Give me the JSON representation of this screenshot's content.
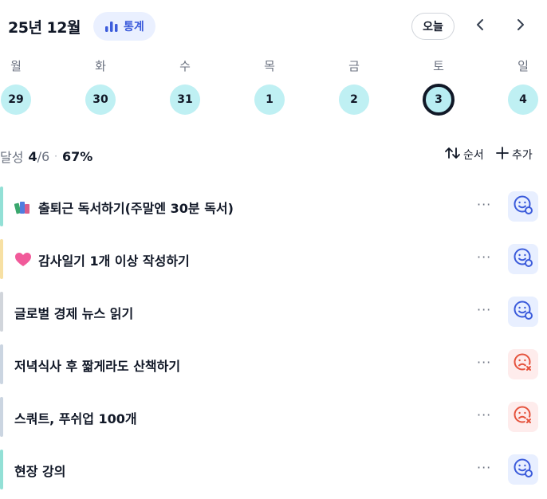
{
  "header": {
    "month_title": "25년 12월",
    "stats_label": "통계",
    "today_label": "오늘",
    "prev_icon": "chevron-left-icon",
    "next_icon": "chevron-right-icon"
  },
  "week": {
    "weekdays": [
      "월",
      "화",
      "수",
      "목",
      "금",
      "토",
      "일"
    ],
    "dates": [
      "29",
      "30",
      "31",
      "1",
      "2",
      "3",
      "4"
    ],
    "selected_index": 5
  },
  "summary": {
    "label": "달성",
    "done": "4",
    "total": "/6",
    "separator": "·",
    "percent": "67%",
    "order_label": "순서",
    "add_label": "추가"
  },
  "habits": [
    {
      "title": "출퇴근 독서하기(주말엔 30분 독서)",
      "emoji": "books-icon",
      "bar_color": "#93e0d6",
      "status": "success"
    },
    {
      "title": "감사일기 1개 이상 작성하기",
      "emoji": "heart-icon",
      "bar_color": "#f7e0a3",
      "status": "success"
    },
    {
      "title": "글로벌 경제 뉴스 읽기",
      "emoji": "",
      "bar_color": "#d1d5db",
      "status": "success"
    },
    {
      "title": "저녁식사 후 짧게라도 산책하기",
      "emoji": "",
      "bar_color": "#cbd5e1",
      "status": "failed"
    },
    {
      "title": "스쿼트, 푸쉬업 100개",
      "emoji": "",
      "bar_color": "#cbd5e1",
      "status": "failed"
    },
    {
      "title": "현장 강의",
      "emoji": "",
      "bar_color": "#93e0d6",
      "status": "success"
    }
  ],
  "more_label": "···",
  "colors": {
    "accent": "#3b5bdb",
    "day_circle": "#bff0f3",
    "success_bg": "#e8efff",
    "fail_bg": "#feecec",
    "fail_icon": "#e5533d"
  }
}
